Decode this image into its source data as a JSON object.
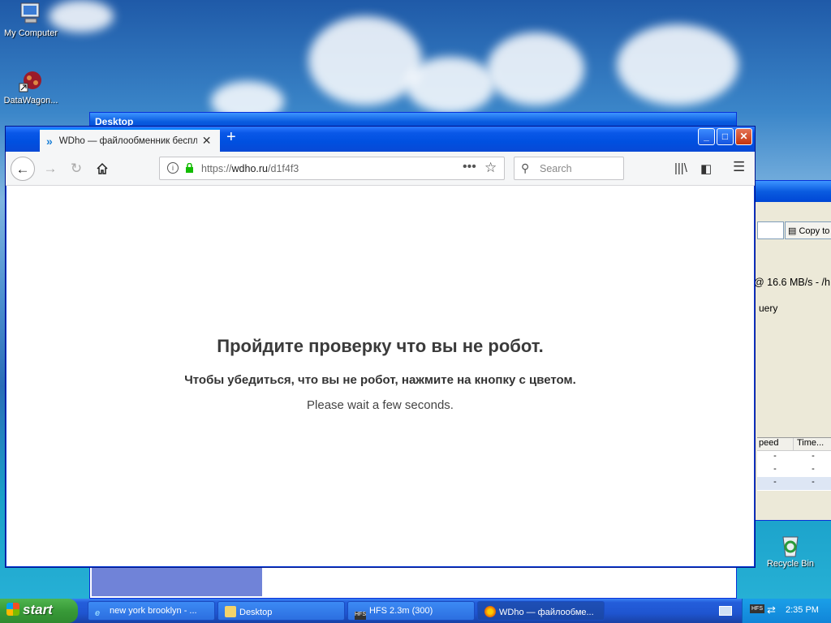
{
  "desktop": {
    "icons": [
      {
        "label": "My Computer"
      },
      {
        "label": "DataWagon..."
      },
      {
        "label": "Recycle Bin"
      }
    ]
  },
  "background_window": {
    "title": "Desktop",
    "copy_button": "Copy to",
    "speed_text": "@ 16.6 MB/s - /h",
    "query_text": "uery",
    "table_headers": [
      "peed",
      "Time..."
    ],
    "table_rows": [
      [
        "-",
        "-"
      ],
      [
        "-",
        "-"
      ],
      [
        "-",
        "-"
      ]
    ]
  },
  "browser": {
    "tab_title": "WDho — файлообменник бесплатно",
    "url_prefix": "https://",
    "url_domain": "wdho.ru",
    "url_path": "/d1f4f3",
    "search_placeholder": "Search"
  },
  "page": {
    "heading": "Пройдите проверку что вы не робот.",
    "subheading": "Чтобы убедиться, что вы не робот, нажмите на кнопку с цветом.",
    "wait_text": "Please wait a few seconds."
  },
  "taskbar": {
    "start_label": "start",
    "tasks": [
      {
        "label": "new york brooklyn - ..."
      },
      {
        "label": "Desktop"
      },
      {
        "label": "HFS 2.3m (300)"
      },
      {
        "label": "WDho — файлообме..."
      }
    ],
    "clock": "2:35 PM"
  }
}
